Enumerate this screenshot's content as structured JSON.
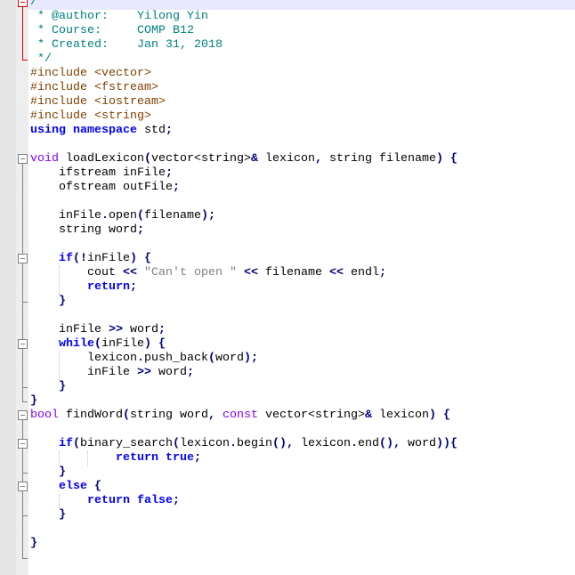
{
  "editor": {
    "colors": {
      "comment": "#008080",
      "preprocessor": "#804000",
      "keyword": "#0000ff",
      "type": "#8000ff",
      "operator": "#000080",
      "string": "#808080",
      "current_line": "#e8e8ff"
    },
    "lines": [
      [
        [
          "cm",
          "/**"
        ]
      ],
      [
        [
          "cm",
          " * @author:    Yilong Yin"
        ]
      ],
      [
        [
          "cm",
          " * Course:     COMP B12"
        ]
      ],
      [
        [
          "cm",
          " * Created:    Jan 31, 2018"
        ]
      ],
      [
        [
          "cm",
          " */"
        ]
      ],
      [
        [
          "pp",
          "#include <vector>"
        ]
      ],
      [
        [
          "pp",
          "#include <fstream>"
        ]
      ],
      [
        [
          "pp",
          "#include <iostream>"
        ]
      ],
      [
        [
          "pp",
          "#include <string>"
        ]
      ],
      [
        [
          "kw",
          "using"
        ],
        [
          "tx",
          " "
        ],
        [
          "kw",
          "namespace"
        ],
        [
          "tx",
          " std"
        ],
        [
          "op",
          ";"
        ]
      ],
      [],
      [
        [
          "ty",
          "void"
        ],
        [
          "tx",
          " loadLexicon"
        ],
        [
          "op",
          "("
        ],
        [
          "tx",
          "vector<string>"
        ],
        [
          "op",
          "&"
        ],
        [
          "tx",
          " lexicon"
        ],
        [
          "op",
          ","
        ],
        [
          "tx",
          " string filename"
        ],
        [
          "op",
          ")"
        ],
        [
          "tx",
          " "
        ],
        [
          "op",
          "{"
        ]
      ],
      [
        [
          "tx",
          "    ifstream inFile"
        ],
        [
          "op",
          ";"
        ]
      ],
      [
        [
          "tx",
          "    ofstream outFile"
        ],
        [
          "op",
          ";"
        ]
      ],
      [],
      [
        [
          "tx",
          "    inFile"
        ],
        [
          "op",
          "."
        ],
        [
          "tx",
          "open"
        ],
        [
          "op",
          "("
        ],
        [
          "tx",
          "filename"
        ],
        [
          "op",
          ");"
        ]
      ],
      [
        [
          "tx",
          "    string word"
        ],
        [
          "op",
          ";"
        ]
      ],
      [],
      [
        [
          "tx",
          "    "
        ],
        [
          "kw",
          "if"
        ],
        [
          "op",
          "(!"
        ],
        [
          "tx",
          "inFile"
        ],
        [
          "op",
          ")"
        ],
        [
          "tx",
          " "
        ],
        [
          "op",
          "{"
        ]
      ],
      [
        [
          "tx",
          "        cout "
        ],
        [
          "op",
          "<<"
        ],
        [
          "tx",
          " "
        ],
        [
          "st",
          "\"Can't open \""
        ],
        [
          "tx",
          " "
        ],
        [
          "op",
          "<<"
        ],
        [
          "tx",
          " filename "
        ],
        [
          "op",
          "<<"
        ],
        [
          "tx",
          " endl"
        ],
        [
          "op",
          ";"
        ]
      ],
      [
        [
          "tx",
          "        "
        ],
        [
          "kw",
          "return"
        ],
        [
          "op",
          ";"
        ]
      ],
      [
        [
          "tx",
          "    "
        ],
        [
          "op",
          "}"
        ]
      ],
      [],
      [
        [
          "tx",
          "    inFile "
        ],
        [
          "op",
          ">>"
        ],
        [
          "tx",
          " word"
        ],
        [
          "op",
          ";"
        ]
      ],
      [
        [
          "tx",
          "    "
        ],
        [
          "kw",
          "while"
        ],
        [
          "op",
          "("
        ],
        [
          "tx",
          "inFile"
        ],
        [
          "op",
          ")"
        ],
        [
          "tx",
          " "
        ],
        [
          "op",
          "{"
        ]
      ],
      [
        [
          "tx",
          "        lexicon"
        ],
        [
          "op",
          "."
        ],
        [
          "tx",
          "push_back"
        ],
        [
          "op",
          "("
        ],
        [
          "tx",
          "word"
        ],
        [
          "op",
          ");"
        ]
      ],
      [
        [
          "tx",
          "        inFile "
        ],
        [
          "op",
          ">>"
        ],
        [
          "tx",
          " word"
        ],
        [
          "op",
          ";"
        ]
      ],
      [
        [
          "tx",
          "    "
        ],
        [
          "op",
          "}"
        ]
      ],
      [
        [
          "op",
          "}"
        ]
      ],
      [
        [
          "ty",
          "bool"
        ],
        [
          "tx",
          " findWord"
        ],
        [
          "op",
          "("
        ],
        [
          "tx",
          "string word"
        ],
        [
          "op",
          ","
        ],
        [
          "tx",
          " "
        ],
        [
          "ty",
          "const"
        ],
        [
          "tx",
          " vector<string>"
        ],
        [
          "op",
          "&"
        ],
        [
          "tx",
          " lexicon"
        ],
        [
          "op",
          ")"
        ],
        [
          "tx",
          " "
        ],
        [
          "op",
          "{"
        ]
      ],
      [],
      [
        [
          "tx",
          "    "
        ],
        [
          "kw",
          "if"
        ],
        [
          "op",
          "("
        ],
        [
          "tx",
          "binary_search"
        ],
        [
          "op",
          "("
        ],
        [
          "tx",
          "lexicon"
        ],
        [
          "op",
          "."
        ],
        [
          "tx",
          "begin"
        ],
        [
          "op",
          "(),"
        ],
        [
          "tx",
          " lexicon"
        ],
        [
          "op",
          "."
        ],
        [
          "tx",
          "end"
        ],
        [
          "op",
          "(),"
        ],
        [
          "tx",
          " word"
        ],
        [
          "op",
          ")){"
        ]
      ],
      [
        [
          "tx",
          "            "
        ],
        [
          "kw",
          "return"
        ],
        [
          "tx",
          " "
        ],
        [
          "kw",
          "true"
        ],
        [
          "op",
          ";"
        ]
      ],
      [
        [
          "tx",
          "    "
        ],
        [
          "op",
          "}"
        ]
      ],
      [
        [
          "tx",
          "    "
        ],
        [
          "kw",
          "else"
        ],
        [
          "tx",
          " "
        ],
        [
          "op",
          "{"
        ]
      ],
      [
        [
          "tx",
          "        "
        ],
        [
          "kw",
          "return"
        ],
        [
          "tx",
          " "
        ],
        [
          "kw",
          "false"
        ],
        [
          "op",
          ";"
        ]
      ],
      [
        [
          "tx",
          "    "
        ],
        [
          "op",
          "}"
        ]
      ],
      [],
      [
        [
          "op",
          "}"
        ]
      ],
      []
    ]
  }
}
